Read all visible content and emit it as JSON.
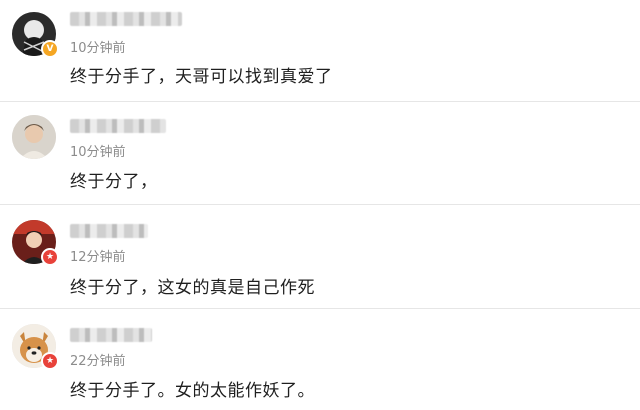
{
  "comments": [
    {
      "time": "10分钟前",
      "text": "终于分手了，天哥可以找到真爱了",
      "badge": {
        "icon": "verified-v-icon",
        "glyph": "V",
        "color": "#f5a623"
      }
    },
    {
      "time": "10分钟前",
      "text": "终于分了，",
      "badge": null
    },
    {
      "time": "12分钟前",
      "text": "终于分了，这女的真是自己作死",
      "badge": {
        "icon": "star-badge-icon",
        "glyph": "★",
        "color": "#e8423a"
      }
    },
    {
      "time": "22分钟前",
      "text": "终于分手了。女的太能作妖了。",
      "badge": {
        "icon": "star-badge-icon",
        "glyph": "★",
        "color": "#e8423a"
      }
    }
  ]
}
